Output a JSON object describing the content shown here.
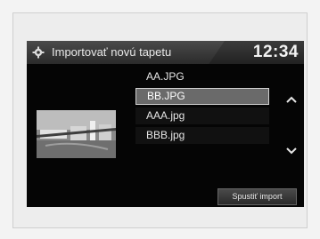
{
  "header": {
    "title": "Importovať novú tapetu",
    "clock": "12:34",
    "settings_icon": "gear-icon"
  },
  "files": [
    {
      "name": "AA.JPG",
      "selected": false
    },
    {
      "name": "BB.JPG",
      "selected": true
    },
    {
      "name": "AAA.jpg",
      "selected": false
    },
    {
      "name": "BBB.jpg",
      "selected": false
    }
  ],
  "scroll": {
    "up_icon": "chevron-up-icon",
    "down_icon": "chevron-down-icon"
  },
  "preview": {
    "icon": "bridge-preview-image"
  },
  "actions": {
    "import_label": "Spustiť import"
  },
  "colors": {
    "screen_bg": "#050505",
    "selected_bg": "#6a6a6a",
    "text": "#e6e6e6"
  }
}
